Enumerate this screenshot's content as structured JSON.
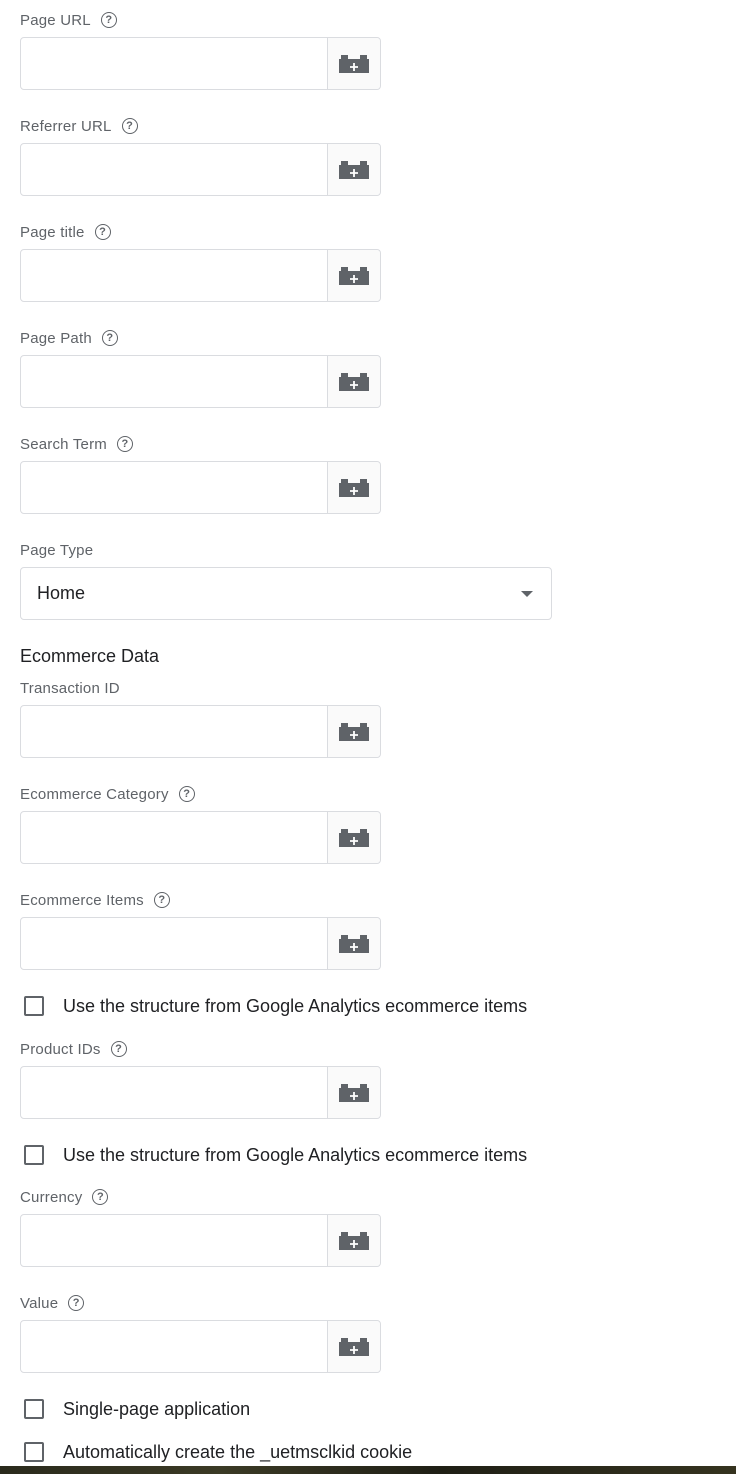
{
  "fields": [
    {
      "id": "page-url",
      "label": "Page URL",
      "help": true,
      "value": ""
    },
    {
      "id": "referrer-url",
      "label": "Referrer URL",
      "help": true,
      "value": ""
    },
    {
      "id": "page-title",
      "label": "Page title",
      "help": true,
      "value": ""
    },
    {
      "id": "page-path",
      "label": "Page Path",
      "help": true,
      "value": ""
    },
    {
      "id": "search-term",
      "label": "Search Term",
      "help": true,
      "value": ""
    },
    {
      "id": "transaction-id",
      "label": "Transaction ID",
      "help": false,
      "value": ""
    },
    {
      "id": "ecommerce-category",
      "label": "Ecommerce Category",
      "help": true,
      "value": ""
    },
    {
      "id": "ecommerce-items",
      "label": "Ecommerce Items",
      "help": true,
      "value": ""
    },
    {
      "id": "product-ids",
      "label": "Product IDs",
      "help": true,
      "value": ""
    },
    {
      "id": "currency",
      "label": "Currency",
      "help": true,
      "value": ""
    },
    {
      "id": "value",
      "label": "Value",
      "help": true,
      "value": ""
    }
  ],
  "page_type": {
    "label": "Page Type",
    "selected": "Home"
  },
  "ecommerce_section_title": "Ecommerce Data",
  "checkboxes": {
    "ga_structure_items": {
      "label": "Use the structure from Google Analytics ecommerce items",
      "checked": false
    },
    "ga_structure_product_ids": {
      "label": "Use the structure from Google Analytics ecommerce items",
      "checked": false
    },
    "single_page_app": {
      "label": "Single-page application",
      "checked": false
    },
    "auto_uetmsclkid": {
      "label": "Automatically create the _uetmsclkid cookie",
      "checked": false
    }
  },
  "icons": {
    "help": "help-circle-icon",
    "variable": "add-variable-icon"
  },
  "help_glyph": "?",
  "colors": {
    "border": "#dadce0",
    "label": "#5f6368",
    "text": "#202124",
    "icon": "#5f6368"
  }
}
